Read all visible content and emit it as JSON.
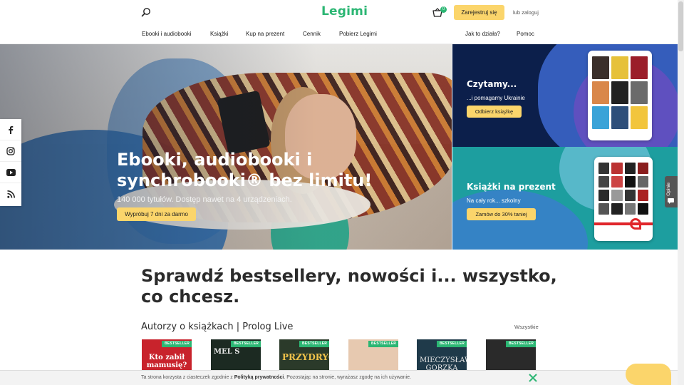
{
  "header": {
    "logo": "Legimi",
    "cart_count": "0",
    "register_label": "Zarejestruj się",
    "login_label": "lub zaloguj"
  },
  "nav": {
    "items": [
      "Ebooki i audiobooki",
      "Książki",
      "Kup na prezent",
      "Cennik",
      "Pobierz Legimi"
    ],
    "right_items": [
      "Jak to działa?",
      "Pomoc"
    ]
  },
  "hero": {
    "title": "Ebooki, audiobooki i synchrobooki® bez limitu!",
    "subtitle": "140 000 tytułów. Dostęp nawet na 4 urządzeniach.",
    "cta": "Wypróbuj 7 dni za darmo"
  },
  "promos": [
    {
      "title": "Czytamy...",
      "subtitle": "...i pomagamy Ukrainie",
      "cta": "Odbierz książkę"
    },
    {
      "title": "Książki na prezent",
      "subtitle": "Na cały rok... szkolny",
      "cta": "Zamów do 30% taniej"
    }
  ],
  "social": [
    "facebook-icon",
    "instagram-icon",
    "youtube-icon",
    "rss-icon"
  ],
  "feedback_label": "Opinie",
  "main": {
    "heading": "Sprawdź bestsellery, nowości i... wszystko, co chcesz.",
    "row_title": "Autorzy o książkach | Prolog Live",
    "all_link": "Wszystkie",
    "books": [
      {
        "badge": "BESTSELLER",
        "cover_text": "Kto zabił mamusię?",
        "bg": "#c8232c",
        "fg": "#ffffff"
      },
      {
        "badge": "BESTSELLER",
        "cover_text": "MEL S",
        "bg": "#1c2a22",
        "fg": "#e9e9e9"
      },
      {
        "badge": "BESTSELLER",
        "cover_text": "PRZYDRYGA",
        "bg": "#2b3a2a",
        "fg": "#f0c24a"
      },
      {
        "badge": "BESTSELLER",
        "cover_text": "",
        "bg": "#e7c9b0",
        "fg": "#333333"
      },
      {
        "badge": "BESTSELLER",
        "cover_text": "MIECZYSŁAW GORZKA",
        "bg": "#1f3a4a",
        "fg": "#e6e6e6"
      },
      {
        "badge": "BESTSELLER",
        "cover_text": "",
        "bg": "#2a2a2a",
        "fg": "#e8c25a"
      }
    ]
  },
  "cookie": {
    "text_before": "Ta strona korzysta z ciasteczek zgodnie z ",
    "policy_link": "Polityką prywatności",
    "text_after": ". Pozostając na stronie, wyrażasz zgodę na ich używanie."
  },
  "colors": {
    "brand": "#2bb673",
    "accent": "#fbd56b",
    "promo_dark": "#0c1f4b",
    "promo_teal": "#1d9e9f"
  }
}
